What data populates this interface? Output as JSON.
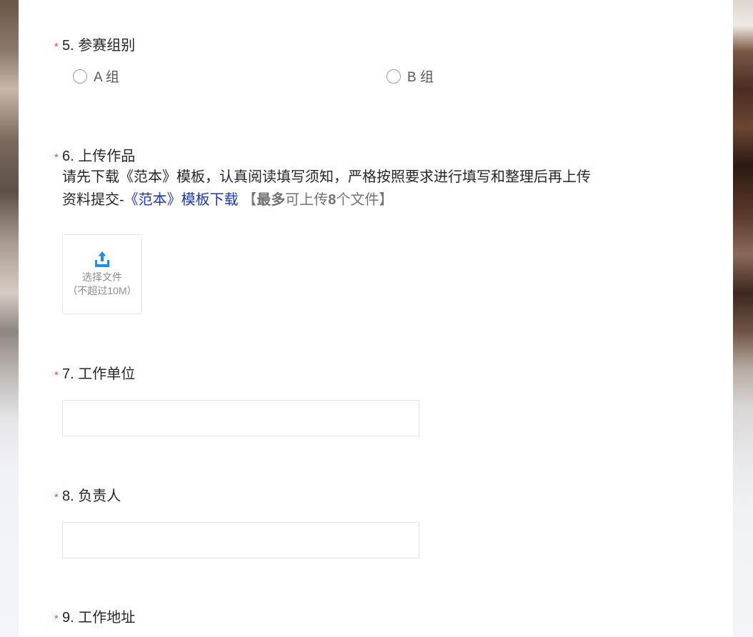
{
  "colors": {
    "required_mark": "#e5484d",
    "link": "#1a36c8",
    "upload_icon": "#1e8fe8"
  },
  "q5": {
    "required": "*",
    "title": "5. 参赛组别",
    "options": [
      "A 组",
      "B 组"
    ]
  },
  "q6": {
    "required": "*",
    "title": "6. 上传作品",
    "desc_line1": "请先下载《范本》模板，认真阅读填写须知，严格按照要求进行填写和整理后再上传",
    "desc_line2_prefix": "资料提交-",
    "template_link": "《范本》模板下载",
    "limit_open": " 【",
    "limit_bold1": "最多",
    "limit_text1": "可上传",
    "limit_bold2": "8",
    "limit_text2": "个文件",
    "limit_close": "】",
    "upload_icon": "upload-tray-icon",
    "upload_label": "选择文件",
    "upload_hint": "（不超过10M）"
  },
  "q7": {
    "required": "*",
    "title": "7. 工作单位",
    "value": ""
  },
  "q8": {
    "required": "*",
    "title": "8. 负责人",
    "value": ""
  },
  "q9": {
    "required": "*",
    "title": "9. 工作地址"
  }
}
